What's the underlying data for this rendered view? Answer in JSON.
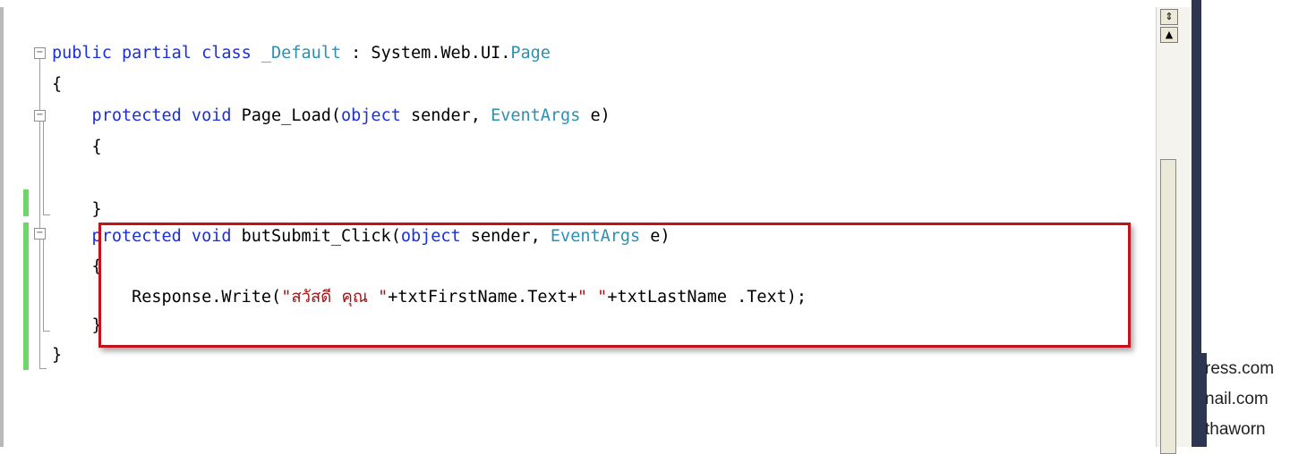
{
  "code": {
    "lines": [
      {
        "parts": [
          {
            "t": "public partial class ",
            "c": "kw"
          },
          {
            "t": "_Default",
            "c": "ty"
          },
          {
            "t": " : System.Web.UI.",
            "c": ""
          },
          {
            "t": "Page",
            "c": "ty"
          }
        ]
      },
      {
        "parts": [
          {
            "t": "{",
            "c": ""
          }
        ]
      },
      {
        "parts": [
          {
            "t": "    protected void ",
            "c": "kw"
          },
          {
            "t": "Page_Load(",
            "c": ""
          },
          {
            "t": "object",
            "c": "kw"
          },
          {
            "t": " sender, ",
            "c": ""
          },
          {
            "t": "EventArgs",
            "c": "ty"
          },
          {
            "t": " e)",
            "c": ""
          }
        ]
      },
      {
        "parts": [
          {
            "t": "    {",
            "c": ""
          }
        ]
      },
      {
        "parts": [
          {
            "t": "",
            "c": ""
          }
        ]
      },
      {
        "parts": [
          {
            "t": "    }",
            "c": ""
          }
        ]
      },
      {
        "parts": [
          {
            "t": "    protected void ",
            "c": "kw"
          },
          {
            "t": "butSubmit_Click(",
            "c": ""
          },
          {
            "t": "object",
            "c": "kw"
          },
          {
            "t": " sender, ",
            "c": ""
          },
          {
            "t": "EventArgs",
            "c": "ty"
          },
          {
            "t": " e)",
            "c": ""
          }
        ]
      },
      {
        "parts": [
          {
            "t": "    {",
            "c": ""
          }
        ]
      },
      {
        "parts": [
          {
            "t": "        Response.Write(",
            "c": ""
          },
          {
            "t": "\"สวัสดี คุณ \"",
            "c": "str"
          },
          {
            "t": "+txtFirstName.Text+",
            "c": ""
          },
          {
            "t": "\" \"",
            "c": "str"
          },
          {
            "t": "+txtLastName .Text);",
            "c": ""
          }
        ]
      },
      {
        "parts": [
          {
            "t": "    }",
            "c": ""
          }
        ]
      },
      {
        "parts": [
          {
            "t": "}",
            "c": ""
          }
        ]
      }
    ]
  },
  "fold": {
    "collapse_symbol": "−"
  },
  "scrollbar": {
    "split_symbol": "⇕",
    "up_symbol": "▲"
  },
  "side_text": {
    "line1": "ress.com",
    "line2": "nail.com",
    "line3": "thaworn"
  },
  "colors": {
    "keyword": "#1a2fe0",
    "type": "#2b91af",
    "string": "#a31515",
    "highlight_border": "#c4121c",
    "change_bar": "#6fd669"
  }
}
